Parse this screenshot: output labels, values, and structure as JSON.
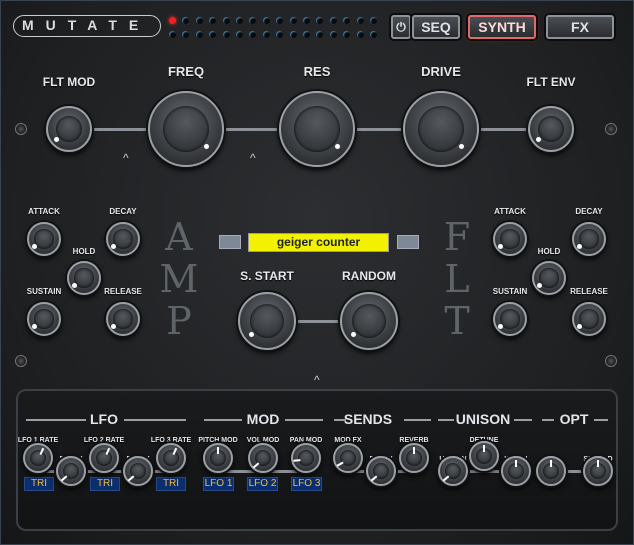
{
  "logo": "MUTATE",
  "step_leds": {
    "rows": 2,
    "cols": 16,
    "active": [
      0
    ]
  },
  "tabs": {
    "power": "power",
    "seq": "SEQ",
    "synth": "SYNTH",
    "fx": "FX",
    "active": "SYNTH"
  },
  "filter": {
    "flt_mod": "FLT MOD",
    "freq": "FREQ",
    "res": "RES",
    "drive": "DRIVE",
    "flt_env": "FLT ENV"
  },
  "amp_env": {
    "title_letters": [
      "A",
      "M",
      "P"
    ],
    "attack": "ATTACK",
    "decay": "DECAY",
    "hold": "HOLD",
    "sustain": "SUSTAIN",
    "release": "RELEASE"
  },
  "flt_env": {
    "title_letters": [
      "F",
      "L",
      "T"
    ],
    "attack": "ATTACK",
    "decay": "DECAY",
    "hold": "HOLD",
    "sustain": "SUSTAIN",
    "release": "RELEASE"
  },
  "sample": {
    "name": "geiger counter",
    "s_start": "S. START",
    "random": "RANDOM"
  },
  "sections": {
    "lfo": "LFO",
    "mod": "MOD",
    "sends": "SENDS",
    "unison": "UNISON",
    "opt": "OPT"
  },
  "bottom": {
    "lfo1_rate": "LFO 1 RATE",
    "delay1": "DELAY",
    "lfo2_rate": "LFO 2 RATE",
    "delay2": "DELAY",
    "lfo3_rate": "LFO 3 RATE",
    "pitch_mod": "PITCH MOD",
    "vol_mod": "VOL MOD",
    "pan_mod": "PAN MOD",
    "mod_fx": "MOD FX",
    "delay": "DELAY",
    "reverb": "REVERB",
    "unison": "UNISON",
    "detune": "DETUNE",
    "width": "WIDTH",
    "vel": "VEL",
    "spread": "SPREAD"
  },
  "tags": {
    "lfo1_shape": "TRI",
    "lfo2_shape": "TRI",
    "lfo3_shape": "TRI",
    "pitch_src": "LFO 1",
    "vol_src": "LFO 2",
    "pan_src": "LFO 3"
  },
  "colors": {
    "accent": "#e03030",
    "display": "#f2f200",
    "tag_bg": "#0b2f6e",
    "tag_text": "#f0c040"
  }
}
